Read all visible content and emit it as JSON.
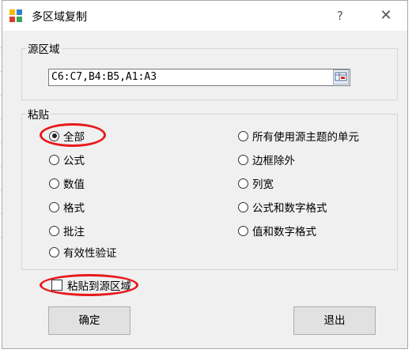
{
  "window": {
    "title": "多区域复制",
    "help_label": "?",
    "close_label": "✕"
  },
  "source_group": {
    "label": "源区域",
    "range_value": "C6:C7,B4:B5,A1:A3",
    "range_button_icon": "range-select-icon"
  },
  "paste_group": {
    "label": "粘贴",
    "left_options": [
      {
        "label": "全部",
        "checked": true
      },
      {
        "label": "公式",
        "checked": false
      },
      {
        "label": "数值",
        "checked": false
      },
      {
        "label": "格式",
        "checked": false
      },
      {
        "label": "批注",
        "checked": false
      },
      {
        "label": "有效性验证",
        "checked": false
      }
    ],
    "right_options": [
      {
        "label": "所有使用源主题的单元",
        "checked": false
      },
      {
        "label": "边框除外",
        "checked": false
      },
      {
        "label": "列宽",
        "checked": false
      },
      {
        "label": "公式和数字格式",
        "checked": false
      },
      {
        "label": "值和数字格式",
        "checked": false
      }
    ]
  },
  "paste_to_source": {
    "label": "粘贴到源区域",
    "checked": false
  },
  "buttons": {
    "ok": "确定",
    "exit": "退出"
  },
  "annotation_color": "#e8191a"
}
